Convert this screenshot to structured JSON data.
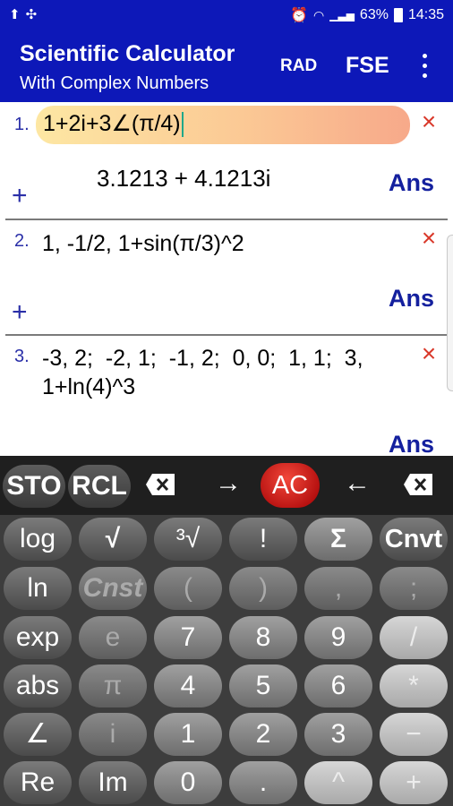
{
  "status_bar": {
    "left_icons": [
      "upload-icon",
      "wifi-transfer-icon"
    ],
    "right_icons": [
      "alarm-icon",
      "wifi-icon",
      "signal-icon",
      "battery-icon"
    ],
    "battery": "63%",
    "time": "14:35"
  },
  "app_bar": {
    "title": "Scientific Calculator",
    "subtitle": "With Complex Numbers",
    "angle_mode": "RAD",
    "format_mode": "FSE",
    "colors": {
      "background": "#0d18b8"
    }
  },
  "entries": [
    {
      "number": "1.",
      "expression": "1+2i+3∠(π/4)",
      "result": "3.1213 + 4.1213i",
      "ans": "Ans",
      "plus": "+",
      "close": "×"
    },
    {
      "number": "2.",
      "expression": "1, -1/2, 1+sin(π/3)^2",
      "ans": "Ans",
      "plus": "+",
      "close": "×"
    },
    {
      "number": "3.",
      "expression_line1": "-3, 2;  -2, 1;  -1, 2;  0, 0;  1, 1;  3,",
      "expression_line2": "1+ln(4)^3",
      "ans": "Ans",
      "close": "×"
    }
  ],
  "toolbar": {
    "sto": "STO",
    "rcl": "RCL",
    "clear_entry_icon": "x-box-icon",
    "right_arrow": "→",
    "ac": "AC",
    "left_arrow": "←",
    "backspace_icon": "backspace-icon",
    "colors": {
      "ac": "#d01818"
    }
  },
  "keys": {
    "row1": [
      "log",
      "√",
      "³√",
      "!",
      "Σ",
      "Cnvt"
    ],
    "row2": [
      "ln",
      "Cnst",
      "(",
      ")",
      ",",
      ";"
    ],
    "row3": [
      "exp",
      "e",
      "7",
      "8",
      "9",
      "/"
    ],
    "row4": [
      "abs",
      "π",
      "4",
      "5",
      "6",
      "*"
    ],
    "row5": [
      "∠",
      "i",
      "1",
      "2",
      "3",
      "−"
    ],
    "row6": [
      "Re",
      "Im",
      "0",
      ".",
      "^",
      "+"
    ]
  }
}
